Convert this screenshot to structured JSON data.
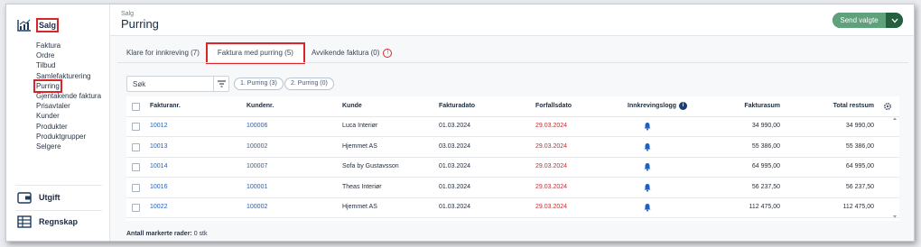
{
  "sidebar": {
    "sections": [
      {
        "label": "Salg",
        "icon": "chart-icon"
      },
      {
        "label": "Utgift",
        "icon": "wallet-icon"
      },
      {
        "label": "Regnskap",
        "icon": "ledger-icon"
      }
    ],
    "salg_items": [
      "Faktura",
      "Ordre",
      "Tilbud",
      "Samlefakturering",
      "Purring",
      "Gjentakende faktura",
      "Prisavtaler",
      "Kunder",
      "Produkter",
      "Produktgrupper",
      "Selgere"
    ],
    "active_item": "Purring"
  },
  "header": {
    "breadcrumb": "Salg",
    "title": "Purring",
    "send_button": "Send valgte"
  },
  "tabs": [
    {
      "label": "Klare for innkreving (7)"
    },
    {
      "label": "Faktura med purring (5)"
    },
    {
      "label": "Avvikende faktura (0)"
    }
  ],
  "search": {
    "placeholder": "Søk"
  },
  "filter_chips": [
    "1. Purring (3)",
    "2. Purring (0)"
  ],
  "table": {
    "columns": [
      "Fakturanr.",
      "Kundenr.",
      "Kunde",
      "Fakturadato",
      "Forfallsdato",
      "Innkrevingslogg",
      "Fakturasum",
      "Total restsum"
    ],
    "rows": [
      [
        "10012",
        "100006",
        "Luca Interiør",
        "01.03.2024",
        "29.03.2024",
        "34 990,00",
        "34 990,00"
      ],
      [
        "10013",
        "100002",
        "Hjemmet AS",
        "03.03.2024",
        "29.03.2024",
        "55 386,00",
        "55 386,00"
      ],
      [
        "10014",
        "100007",
        "Sofa by Gustavsson",
        "01.03.2024",
        "29.03.2024",
        "64 995,00",
        "64 995,00"
      ],
      [
        "10016",
        "100001",
        "Theas Interiør",
        "01.03.2024",
        "29.03.2024",
        "56 237,50",
        "56 237,50"
      ],
      [
        "10022",
        "100002",
        "Hjemmet AS",
        "01.03.2024",
        "29.03.2024",
        "112 475,00",
        "112 475,00"
      ]
    ]
  },
  "footer": {
    "label": "Antall markerte rader:",
    "value": "0 stk"
  },
  "colors": {
    "accent": "#2a5fb0",
    "danger": "#d6262c",
    "send": "#5fa17a"
  }
}
